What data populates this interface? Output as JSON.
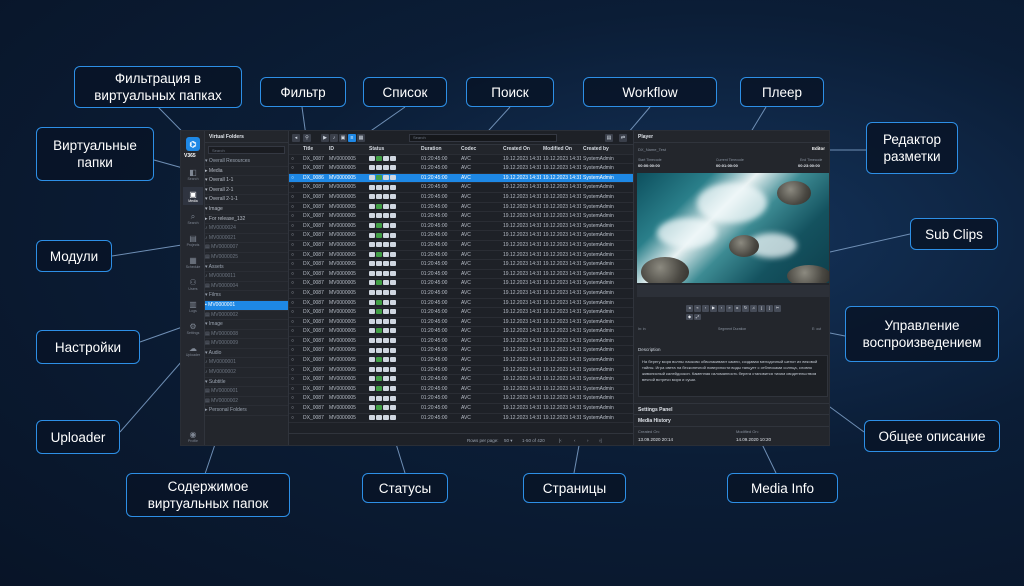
{
  "callouts": {
    "virtual_folder_filter": "Фильтрация в\nвиртуальных папках",
    "filter": "Фильтр",
    "list": "Список",
    "search": "Поиск",
    "workflow": "Workflow",
    "player": "Плеер",
    "markup_editor": "Редактор\nразметки",
    "virtual_folders": "Виртуальные\nпапки",
    "sub_clips": "Sub Clips",
    "modules": "Модули",
    "playback_control": "Управление\nвоспроизведением",
    "settings": "Настройки",
    "general_description": "Общее описание",
    "uploader": "Uploader",
    "folder_contents": "Содержимое\nвиртуальных папок",
    "statuses": "Статусы",
    "pages": "Страницы",
    "media_info": "Media Info"
  },
  "app": {
    "brand": "V365",
    "rail": [
      {
        "icon": "◧",
        "label": "Search"
      },
      {
        "icon": "▣",
        "label": "Media"
      },
      {
        "icon": "⌕",
        "label": "Search"
      },
      {
        "icon": "▤",
        "label": "Projects"
      },
      {
        "icon": "▦",
        "label": "Schedule"
      },
      {
        "icon": "⚇",
        "label": "Users"
      },
      {
        "icon": "▥",
        "label": "Logs"
      },
      {
        "icon": "⚙",
        "label": "Settings"
      },
      {
        "icon": "☁",
        "label": "Uploader"
      },
      {
        "icon": "◉",
        "label": "Profile"
      }
    ],
    "folders": {
      "title": "Virtual Folders",
      "search_placeholder": "Search",
      "items": [
        {
          "label": "▾ Overall Resources",
          "kind": "section"
        },
        {
          "label": "  ▸ Media",
          "kind": "normal"
        },
        {
          "label": "    ▾ Overall 1-1",
          "kind": "normal"
        },
        {
          "label": "      ▾ Overall 2-1",
          "kind": "normal"
        },
        {
          "label": "        ▾ Overall 2-1-1",
          "kind": "normal"
        },
        {
          "label": "          ▾ Image",
          "kind": "normal"
        },
        {
          "label": "            ▸ For release_132",
          "kind": "normal"
        },
        {
          "label": "    ♪ MV0000024",
          "kind": "dim"
        },
        {
          "label": "    ♪ MV0000021",
          "kind": "dim"
        },
        {
          "label": "    ▤ MV0000007",
          "kind": "dim"
        },
        {
          "label": "    ▤ MV0000025",
          "kind": "dim"
        },
        {
          "label": "▾ Assets",
          "kind": "section"
        },
        {
          "label": "    ♪ MV0000011",
          "kind": "dim"
        },
        {
          "label": "    ▤ MV0000004",
          "kind": "dim"
        },
        {
          "label": "▾ Films",
          "kind": "section"
        },
        {
          "label": "  ▪ MV0000001",
          "kind": "selected"
        },
        {
          "label": "    ▤ MV0000002",
          "kind": "dim"
        },
        {
          "label": "▾ Image",
          "kind": "section"
        },
        {
          "label": "    ▤ MV0000008",
          "kind": "dim"
        },
        {
          "label": "    ▤ MV0000009",
          "kind": "dim"
        },
        {
          "label": "▾ Audio",
          "kind": "section"
        },
        {
          "label": "    ♪ MV0000001",
          "kind": "dim"
        },
        {
          "label": "    ♪ MV0000002",
          "kind": "dim"
        },
        {
          "label": "▾ Subtitle",
          "kind": "section"
        },
        {
          "label": "    ▤ MV0000001",
          "kind": "dim"
        },
        {
          "label": "    ▤ MV0000002",
          "kind": "dim"
        },
        {
          "label": "▸ Personal Folders",
          "kind": "section"
        }
      ]
    },
    "table": {
      "search_placeholder": "Search",
      "columns": [
        "",
        "Title",
        "ID",
        "Status",
        "Duration",
        "Codec",
        "Created On",
        "Modified On",
        "Created by"
      ],
      "row_title": "DX_0087",
      "selected_title": "DX_0086",
      "row_id": "MV0000005",
      "row_duration": "01:20:45:00",
      "row_codec": "AVC",
      "row_created": "19.12.2023 14:31",
      "row_modified": "19.12.2023 14:31",
      "row_by": "SystemAdmin",
      "row_count": 28,
      "selected_index": 2
    },
    "pager": {
      "rows_label": "Rows per page:",
      "rows_value": "50 ▾",
      "range": "1-50 of 420",
      "first": "|‹",
      "prev": "‹",
      "next": "›",
      "last": "›|"
    },
    "player": {
      "title": "Player",
      "subtitle": "DX_Name_Test",
      "editor": "Editor",
      "start_label": "Start Timecode",
      "current_label": "Current Timecode",
      "end_label": "End Timecode",
      "start_tc": "00:00:00:00",
      "current_tc": "00:01:00:00",
      "end_tc": "00:23:00:00",
      "in_label": "In: in",
      "seg_label": "Segment Duration",
      "out_label": "E: out",
      "description_title": "Description",
      "description": "На берегу моря волны ласково обволакивают камни, создавая мелодичный шепот их вековой тайны. Игра света на бесконечной поверхности воды танцует с отблесками солнца, словно живописный калейдоскоп. Каменная изломанность берега становится тихим свидетельством вечной встречи моря и суши.",
      "settings_panel": "Settings Panel",
      "media_history": "Media History",
      "created_label": "Created On:",
      "modified_label": "Modified On:",
      "created_value": "13.09.2020 20:14",
      "modified_value": "14.09.2020 10:20"
    }
  }
}
